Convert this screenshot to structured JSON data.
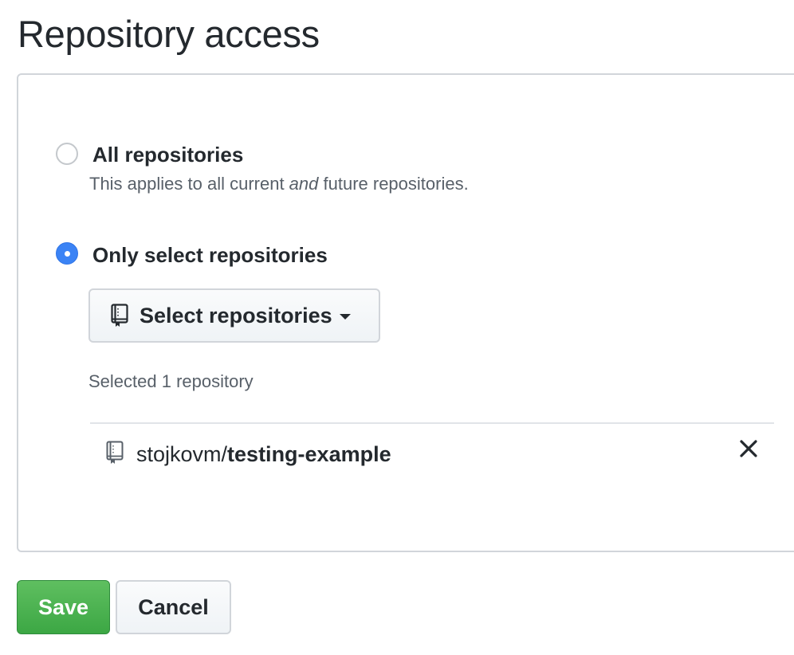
{
  "page": {
    "title": "Repository access"
  },
  "options": {
    "all": {
      "label": "All repositories",
      "note_prefix": "This applies to all current ",
      "note_emphasis": "and",
      "note_suffix": " future repositories.",
      "selected": false
    },
    "only": {
      "label": "Only select repositories",
      "selected": true
    }
  },
  "select_button": {
    "label": "Select repositories",
    "icon": "repo-icon"
  },
  "selection": {
    "count_text": "Selected 1 repository",
    "repos": [
      {
        "owner": "stojkovm",
        "separator": "/",
        "name": "testing-example",
        "icon": "repo-icon",
        "remove_icon": "close-icon"
      }
    ]
  },
  "actions": {
    "save_label": "Save",
    "cancel_label": "Cancel"
  },
  "colors": {
    "accent_radio": "#3b83f5",
    "save_green": "#4caf50",
    "text": "#24292e",
    "muted_text": "#586069",
    "border": "#d1d5da"
  }
}
